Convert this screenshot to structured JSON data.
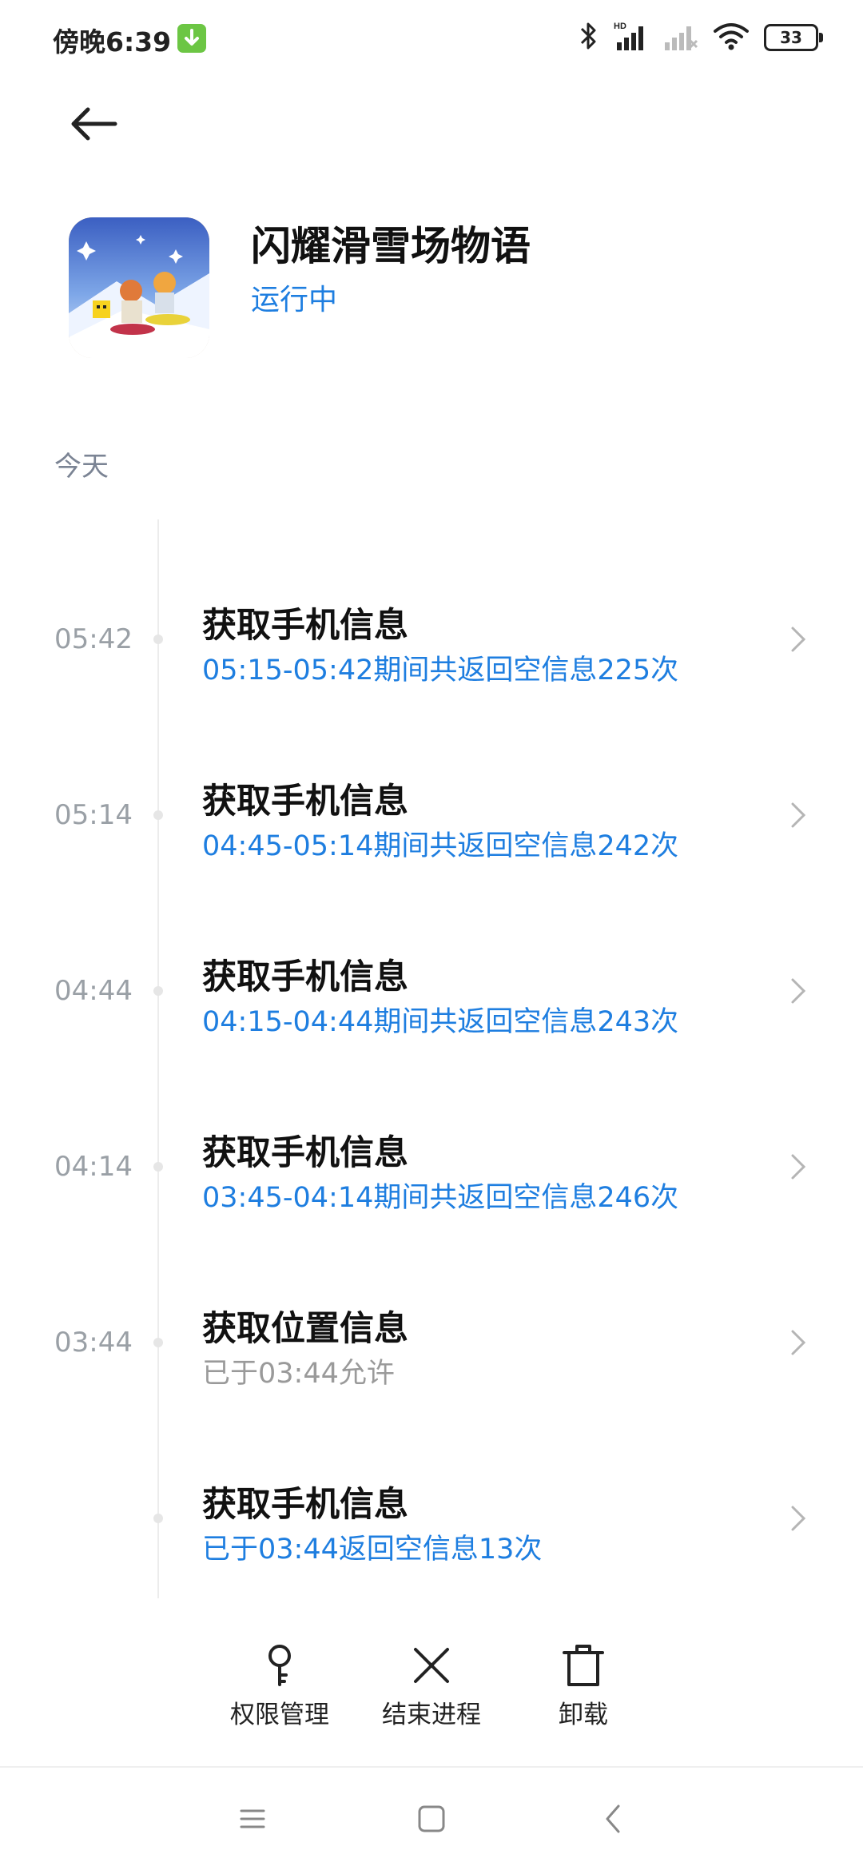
{
  "status_bar": {
    "time": "傍晚6:39",
    "battery": "33",
    "icons": [
      "download-icon",
      "bluetooth-icon",
      "hd-signal-icon",
      "signal-icon",
      "wifi-icon",
      "battery-icon"
    ],
    "download_color": "#6cc644"
  },
  "app": {
    "name": "闪耀滑雪场物语",
    "status": "运行中"
  },
  "section": {
    "label": "今天"
  },
  "timeline": [
    {
      "time": "05:42",
      "title": "获取手机信息",
      "subtitle": "05:15-05:42期间共返回空信息225次",
      "subtitle_style": "blue"
    },
    {
      "time": "05:14",
      "title": "获取手机信息",
      "subtitle": "04:45-05:14期间共返回空信息242次",
      "subtitle_style": "blue"
    },
    {
      "time": "04:44",
      "title": "获取手机信息",
      "subtitle": "04:15-04:44期间共返回空信息243次",
      "subtitle_style": "blue"
    },
    {
      "time": "04:14",
      "title": "获取手机信息",
      "subtitle": "03:45-04:14期间共返回空信息246次",
      "subtitle_style": "blue"
    },
    {
      "time": "03:44",
      "title": "获取位置信息",
      "subtitle": "已于03:44允许",
      "subtitle_style": "gray"
    },
    {
      "time": "",
      "title": "获取手机信息",
      "subtitle": "已于03:44返回空信息13次",
      "subtitle_style": "blue"
    }
  ],
  "actions": {
    "permissions": "权限管理",
    "end_process": "结束进程",
    "uninstall": "卸载"
  },
  "colors": {
    "accent": "#1e7ee0",
    "muted": "#9aa0a6",
    "section": "#7b8494"
  }
}
